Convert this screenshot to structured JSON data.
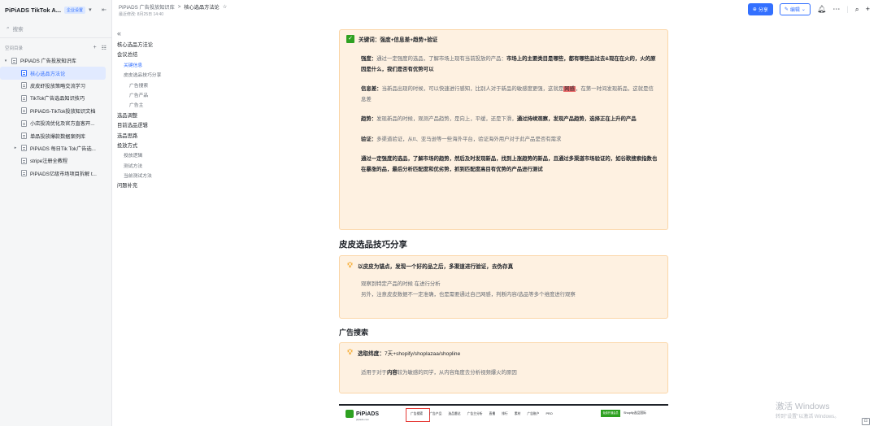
{
  "sidebar": {
    "title": "PiPiADS TikTok A...",
    "badge": "企业设置",
    "search_placeholder": "搜索",
    "space_label": "空间目录",
    "tree": [
      {
        "label": "PiPiADS 广告投放知识库",
        "level": 0,
        "expand": "▾"
      },
      {
        "label": "核心选品方法论",
        "level": 1,
        "active": true
      },
      {
        "label": "皮皮虾投放策略交流学习",
        "level": 1
      },
      {
        "label": "TikTok广告选品知识技巧",
        "level": 1
      },
      {
        "label": "PiPiADS-TikTok投放知识文档",
        "level": 1
      },
      {
        "label": "小店投流优化及官方直客开...",
        "level": 1
      },
      {
        "label": "单品投放爆款数据案例库",
        "level": 1
      },
      {
        "label": "PiPiADS 每日Tik Tok广告选...",
        "level": 1,
        "expand": "▸"
      },
      {
        "label": "stripe注册全教程",
        "level": 1
      },
      {
        "label": "PiPiADS亿级市场项目拆解 t...",
        "level": 1
      }
    ]
  },
  "topbar": {
    "crumb_root": "PiPiADS 广告投放知识库",
    "crumb_sep": ">",
    "crumb_current": "核心选品方法论",
    "last_modified": "最近修改: 8月25日 14:40",
    "share_label": "分享",
    "edit_label": "编辑"
  },
  "toc": {
    "items": [
      {
        "label": "核心选品方法论",
        "level": 1
      },
      {
        "label": "会议总结",
        "level": 1
      },
      {
        "label": "关键信息",
        "level": 2,
        "active": true
      },
      {
        "label": "皮皮选品技巧分享",
        "level": 2
      },
      {
        "label": "广告搜索",
        "level": 3
      },
      {
        "label": "广告产品",
        "level": 3
      },
      {
        "label": "广告主",
        "level": 3
      },
      {
        "label": "选品调整",
        "level": 1
      },
      {
        "label": "目前选品逻辑",
        "level": 1
      },
      {
        "label": "选品思路",
        "level": 1
      },
      {
        "label": "投放方式",
        "level": 1
      },
      {
        "label": "投放逻辑",
        "level": 2
      },
      {
        "label": "测试方法",
        "level": 2
      },
      {
        "label": "当前测试方法",
        "level": 2
      },
      {
        "label": "问题补充",
        "level": 1
      }
    ]
  },
  "content": {
    "callout1": {
      "title": "关键词：强度+信息差+趋势+验证",
      "p1_label": "强度：",
      "p1_text": "通过一定强度的选品，了解市场上现有当前投放的产品：",
      "p1_bold": "市场上的主要类目是哪些，都有哪些品过去&现在在火的，火的原因是什么，我们是否有优势可以",
      "p2_label": "信息差：",
      "p2_text_a": "当新品出现的时候，可以快速进行感知，比别人对于新品的敏感度更强，这就是",
      "p2_highlight": "网感",
      "p2_text_b": "，在第一时间发现新品，这就是信息差",
      "p3_label": "趋势：",
      "p3_text": "发现新品的时候，观测产品趋势，是向上，平缓，还是下滑，",
      "p3_bold": "通过持续观察，发现产品趋势，选择正在上升的产品",
      "p4_label": "验证：",
      "p4_text": "多渠道验证，从tt、亚马逊等一些海外平台，验证海外用户对于此产品是否有需求",
      "p5_bold": "通过一定强度的选品，了解市场的趋势，然后及时发现新品，找到上涨趋势的新品，且通过多渠道市场验证的，如谷歌搜索指数也在暴涨的品，最后分析匹配度和优劣势，抓到匹配度高目有优势的产品进行测试"
    },
    "section1_title": "皮皮选品技巧分享",
    "callout2": {
      "title": "以皮皮为锚点，发现一个好的品之后，多渠道进行验证，去伪存真",
      "p1": "观察到特定产品的时候 在进行分析",
      "p2": "另外，注意皮皮数据不一定准确，也是需要通过自己网感，判断内容/选品等多个维度进行观察"
    },
    "section2_title": "广告搜索",
    "callout3": {
      "title_label": "选取纬度：",
      "title_text": "7天+shopify/shoplazaa/shopline",
      "p1_a": "适用于对于",
      "p1_bold": "内容",
      "p1_b": "较为敏感的同学，从内容角度去分析视频爆火的原因"
    },
    "screenshot": {
      "logo": "PiPiADS",
      "logo_sub": "pipiads.com",
      "nav": [
        "广告搜索",
        "广告产品",
        "选品雷达",
        "广告主分析",
        "直播",
        "排行",
        "素材",
        "广告账户",
        "PRO"
      ],
      "cta": "免费开通会员",
      "shopify": "Shopify选品国际"
    }
  },
  "watermark": {
    "line1": "激活 Windows",
    "line2": "转到\"设置\"以激活 Windows。"
  },
  "colors": {
    "accent": "#3370ff",
    "callout_bg": "#fef1e1",
    "callout_border": "#fbd6a8",
    "highlight": "#e96a6a",
    "check_green": "#2ea121"
  }
}
